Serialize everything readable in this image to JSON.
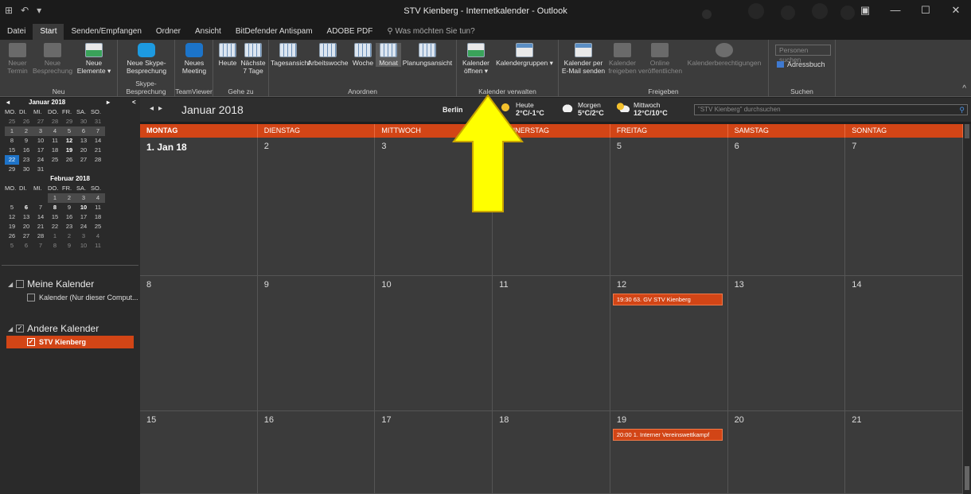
{
  "window": {
    "title": "STV Kienberg - Internetkalender - Outlook",
    "qat": [
      "⊞",
      "↶",
      "▾"
    ],
    "controls": [
      "▣",
      "—",
      "☐",
      "✕"
    ]
  },
  "tabs": [
    "Datei",
    "Start",
    "Senden/Empfangen",
    "Ordner",
    "Ansicht",
    "BitDefender Antispam",
    "ADOBE PDF",
    "Was möchten Sie tun?"
  ],
  "ribbon": {
    "groups": {
      "neu": "Neu",
      "skype": "Skype-Besprechung",
      "teamviewer": "TeamViewer",
      "gehezu": "Gehe zu",
      "anordnen": "Anordnen",
      "verwalten": "Kalender verwalten",
      "freigeben": "Freigeben",
      "suchen": "Suchen"
    },
    "buttons": {
      "neuer_termin": "Neuer Termin",
      "neue_besprechung": "Neue Besprechung",
      "neue_elemente": "Neue Elemente ▾",
      "skype": "Neue Skype-Besprechung",
      "meeting": "Neues Meeting",
      "heute": "Heute",
      "naechste7": "Nächste 7 Tage",
      "tagesansicht": "Tagesansicht",
      "arbeitswoche": "Arbeitswoche",
      "woche": "Woche",
      "monat": "Monat",
      "planungsansicht": "Planungsansicht",
      "kalender_oeffnen": "Kalender öffnen ▾",
      "kalendergruppen": "Kalendergruppen ▾",
      "kalender_email": "Kalender per E-Mail senden",
      "kalender_freigeben": "Kalender freigeben",
      "online_veroeffentlichen": "Online veröffentlichen",
      "berechtigungen": "Kalenderberechtigungen",
      "personen_suchen": "Personen suchen",
      "adressbuch": "Adressbuch"
    }
  },
  "minical": {
    "month1": "Januar 2018",
    "dow": [
      "MO.",
      "DI.",
      "MI.",
      "DO.",
      "FR.",
      "SA.",
      "SO."
    ],
    "month2": "Februar 2018"
  },
  "calendars": {
    "group1": "Meine Kalender",
    "item1": "Kalender (Nur dieser Comput...",
    "group2": "Andere Kalender",
    "item2": "STV Kienberg"
  },
  "header": {
    "month": "Januar 2018",
    "city": "Berlin",
    "weather": [
      {
        "label": "Heute",
        "temp": "2°C/-1°C",
        "icon": "sun-icon"
      },
      {
        "label": "Morgen",
        "temp": "5°C/2°C",
        "icon": "cloud-icon"
      },
      {
        "label": "Mittwoch",
        "temp": "12°C/10°C",
        "icon": "partly-sunny-icon"
      }
    ],
    "search_placeholder": "\"STV Kienberg\" durchsuchen"
  },
  "days": [
    "MONTAG",
    "DIENSTAG",
    "MITTWOCH",
    "DONNERSTAG",
    "FREITAG",
    "SAMSTAG",
    "SONNTAG"
  ],
  "cells": [
    "1. Jan 18",
    "2",
    "3",
    "4",
    "5",
    "6",
    "7",
    "8",
    "9",
    "10",
    "11",
    "12",
    "13",
    "14",
    "15",
    "16",
    "17",
    "18",
    "19",
    "20",
    "21"
  ],
  "events": {
    "e12": "19:30 63. GV STV Kienberg",
    "e19": "20:00 1. Interner Vereinswettkampf"
  },
  "colors": {
    "accent": "#d24516",
    "today": "#1e73c8",
    "arrow": "#ffff00"
  }
}
